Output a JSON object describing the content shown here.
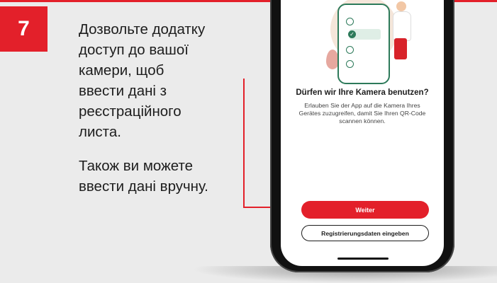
{
  "step": {
    "number": "7"
  },
  "instructions": {
    "paragraph1_lines": [
      "Дозвольте додатку",
      "доступ до вашої",
      "камери, щоб",
      "ввести дані з",
      "реєстраційного",
      "листа."
    ],
    "paragraph2_lines": [
      "Також ви можете",
      "ввести дані вручну."
    ]
  },
  "app_screen": {
    "dialog_title": "Dürfen wir Ihre Kamera benutzen?",
    "dialog_body_lines": [
      "Erlauben Sie der App auf die Kamera Ihres",
      "Gerätes zuzugreifen, damit Sie Ihren QR-Code",
      "scannen können."
    ],
    "primary_button_label": "Weiter",
    "secondary_button_label": "Registrierungsdaten eingeben"
  },
  "colors": {
    "accent": "#e3202a",
    "background": "#ebebeb",
    "illustration_green": "#2d7a5a"
  },
  "icons": [
    "check-icon",
    "illustration-phone-icon",
    "person-illustration-icon",
    "arrow-pointer-icon"
  ]
}
